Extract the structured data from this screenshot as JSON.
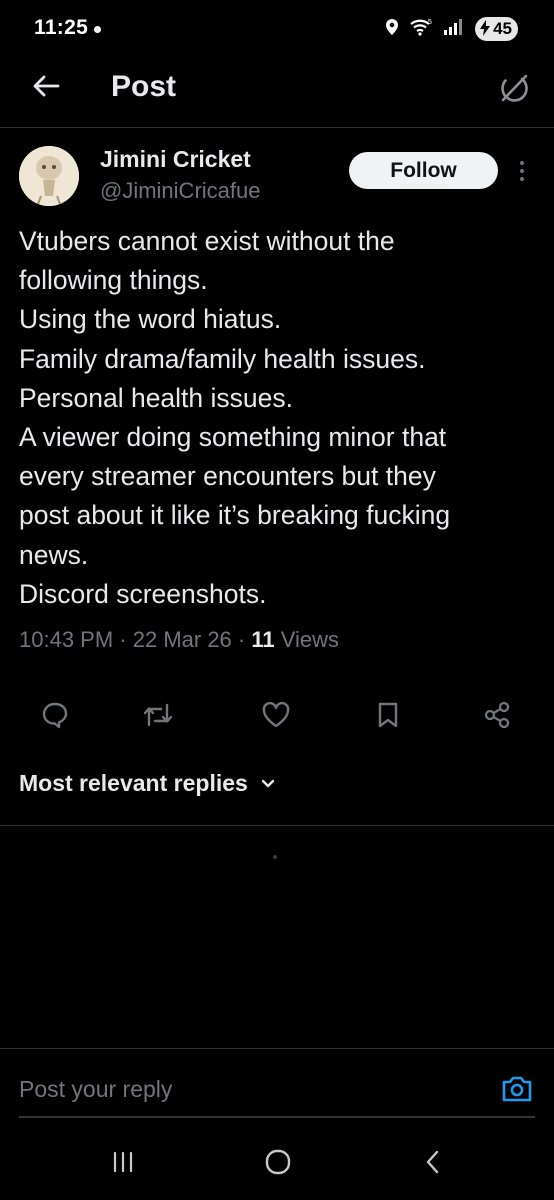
{
  "status_bar": {
    "time": "11:25",
    "battery": "45",
    "icons": [
      "location-icon",
      "wifi-icon",
      "signal-icon",
      "battery-icon"
    ]
  },
  "header": {
    "title": "Post",
    "back_icon": "arrow-left-icon",
    "grok_icon": "grok-icon"
  },
  "post": {
    "author": {
      "name": "Jimini Cricket",
      "handle": "@JiminiCricafue"
    },
    "follow_label": "Follow",
    "lines": [
      "Vtubers cannot exist without the",
      "following things.",
      "Using the word hiatus.",
      "Family drama/family health issues.",
      "Personal health issues.",
      "A viewer doing something minor that",
      "every streamer encounters but they",
      "post about it like it’s breaking fucking",
      "news.",
      "Discord screenshots."
    ],
    "time": "10:43 PM",
    "date": "22 Mar 26",
    "separator": " · ",
    "views_count": "11",
    "views_label": "Views"
  },
  "actions": [
    "reply-icon",
    "repost-icon",
    "like-icon",
    "bookmark-icon",
    "share-icon"
  ],
  "replies": {
    "sort_label": "Most relevant replies"
  },
  "composer": {
    "placeholder": "Post your reply"
  },
  "nav": [
    "recents-icon",
    "home-icon",
    "back-icon"
  ],
  "colors": {
    "background": "#000000",
    "text": "#e7e9ea",
    "secondary": "#71767b",
    "divider": "#2f3336",
    "accent": "#1d9bf0"
  }
}
